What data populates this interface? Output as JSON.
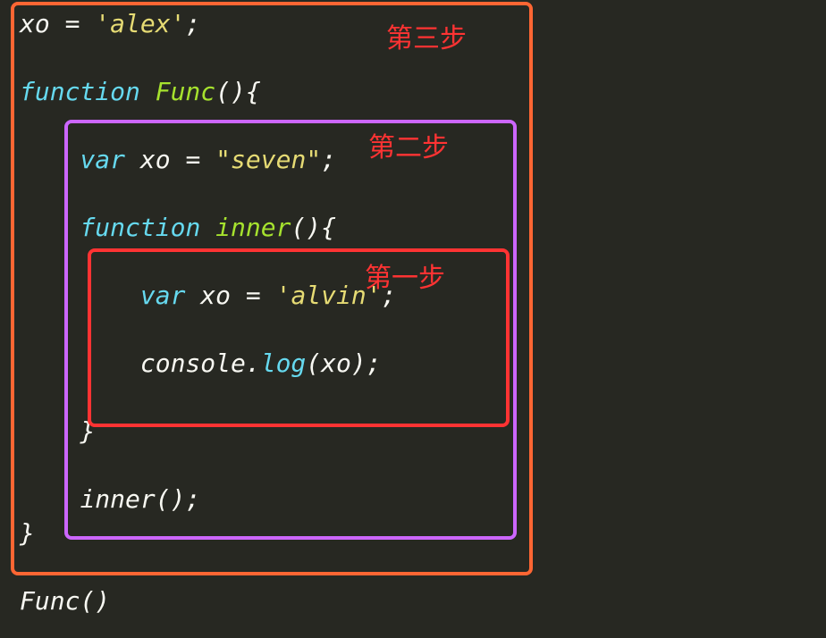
{
  "labels": {
    "step3": "第三步",
    "step2": "第二步",
    "step1": "第一步"
  },
  "code": {
    "line1_xo": "xo",
    "line1_eq": " = ",
    "line1_str": "'alex'",
    "line1_semi": ";",
    "line3_func_kw": "function",
    "line3_space": " ",
    "line3_name": "Func",
    "line3_paren": "(){",
    "line5_var": "var",
    "line5_rest": " xo = ",
    "line5_str": "\"seven\"",
    "line5_semi": ";",
    "line7_func_kw": "function",
    "line7_space": " ",
    "line7_name": "inner",
    "line7_paren": "(){",
    "line9_var": "var",
    "line9_rest": " xo = ",
    "line9_str": "'alvin'",
    "line9_semi": ";",
    "line11_console": "console.",
    "line11_log": "log",
    "line11_call": "(xo);",
    "line13_closebrace": "}",
    "line15_inner": "inner",
    "line15_call": "();",
    "line16_closebrace": "}",
    "line18_func": "Func",
    "line18_call": "()"
  },
  "colors": {
    "outer_box": "#ff6633",
    "mid_box": "#cc66ff",
    "inner_box": "#ff3333",
    "label": "#ff3333"
  }
}
